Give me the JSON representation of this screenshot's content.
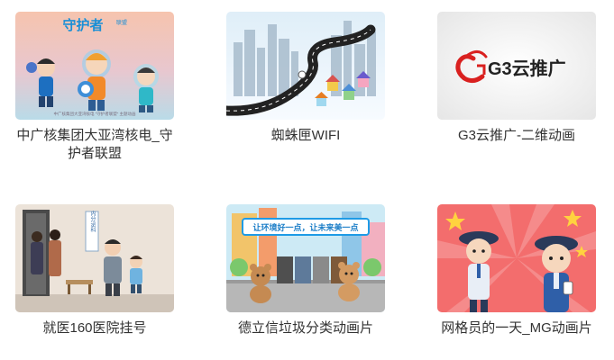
{
  "gallery": {
    "items": [
      {
        "caption": "中广核集团大亚湾核电_守护者联盟",
        "thumb_title": "守护者",
        "thumb_title_badge": "联盟",
        "thumb_footer": "中广核集团大亚湾核电 “守护者联盟” 主题动画",
        "colors": {
          "bg_top": "#f7b9a0",
          "bg_bottom": "#a9d8e8",
          "accent": "#1a8fd6"
        }
      },
      {
        "caption": "蜘蛛匣WIFI",
        "colors": {
          "sky": "#bcd9ef",
          "road": "#2a2a2a",
          "city": "#9cb3c7"
        }
      },
      {
        "caption": "G3云推广-二维动画",
        "logo_text": "G3云推广",
        "colors": {
          "bg": "#f2f2f2",
          "logo_red": "#d9201f",
          "logo_dark": "#333333"
        }
      },
      {
        "caption": "就医160医院挂号",
        "thumb_sign": "内分泌科",
        "colors": {
          "wall": "#e8ddd2",
          "door": "#3b3b3b"
        }
      },
      {
        "caption": "德立信垃圾分类动画片",
        "thumb_banner": "让环境好一点，让未来美一点",
        "colors": {
          "sky": "#c7e6f2",
          "banner": "#1e9be6",
          "ground": "#a7a7a7"
        }
      },
      {
        "caption": "网格员的一天_MG动画片",
        "colors": {
          "bg": "#f47c7c",
          "star": "#ffd23f",
          "uniform": "#2f5fa8"
        }
      }
    ]
  }
}
